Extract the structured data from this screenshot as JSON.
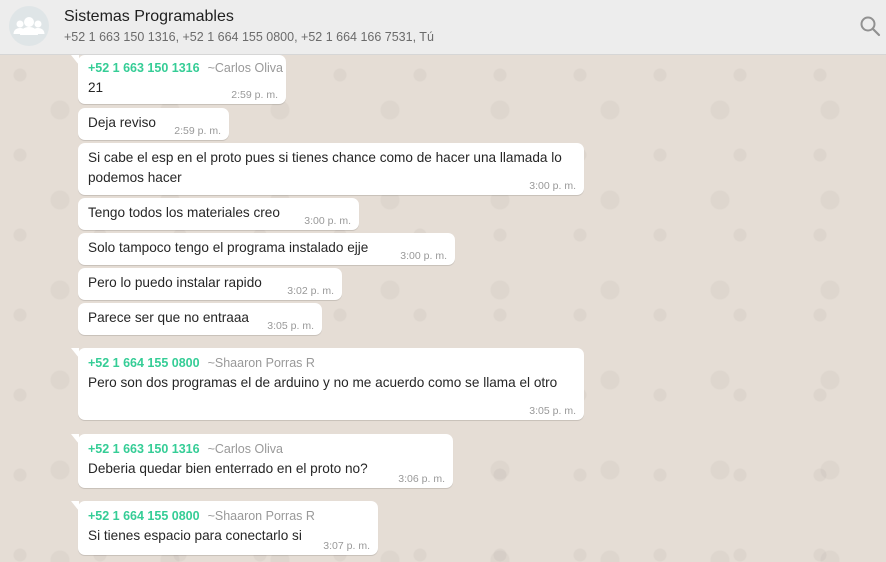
{
  "header": {
    "title": "Sistemas Programables",
    "participants": "+52 1 663 150 1316, +52 1 664 155 0800, +52 1 664 166 7531, Tú"
  },
  "messages": [
    {
      "phone": "+52 1 663 150 1316",
      "alias": "~Carlos Oliva",
      "text": "21",
      "time": "2:59 p. m."
    },
    {
      "text": "Deja reviso",
      "time": "2:59 p. m."
    },
    {
      "text": "Si cabe el esp en el proto pues si tienes chance como de hacer una llamada lo\npodemos hacer",
      "time": "3:00 p. m."
    },
    {
      "text": "Tengo todos los materiales creo",
      "time": "3:00 p. m."
    },
    {
      "text": "Solo tampoco tengo el programa instalado ejje",
      "time": "3:00 p. m."
    },
    {
      "text": "Pero lo puedo instalar rapido",
      "time": "3:02 p. m."
    },
    {
      "text": "Parece ser que no entraaa",
      "time": "3:05 p. m."
    },
    {
      "phone": "+52 1 664 155 0800",
      "alias": "~Shaaron Porras R",
      "text": "Pero son dos programas el de arduino y no me acuerdo como se llama el otro",
      "time": "3:05 p. m."
    },
    {
      "phone": "+52 1 663 150 1316",
      "alias": "~Carlos Oliva",
      "text": "Deberia quedar bien enterrado en el proto no?",
      "time": "3:06 p. m."
    },
    {
      "phone": "+52 1 664 155 0800",
      "alias": "~Shaaron Porras R",
      "text": "Si tienes espacio para conectarlo si",
      "time": "3:07 p. m."
    }
  ]
}
